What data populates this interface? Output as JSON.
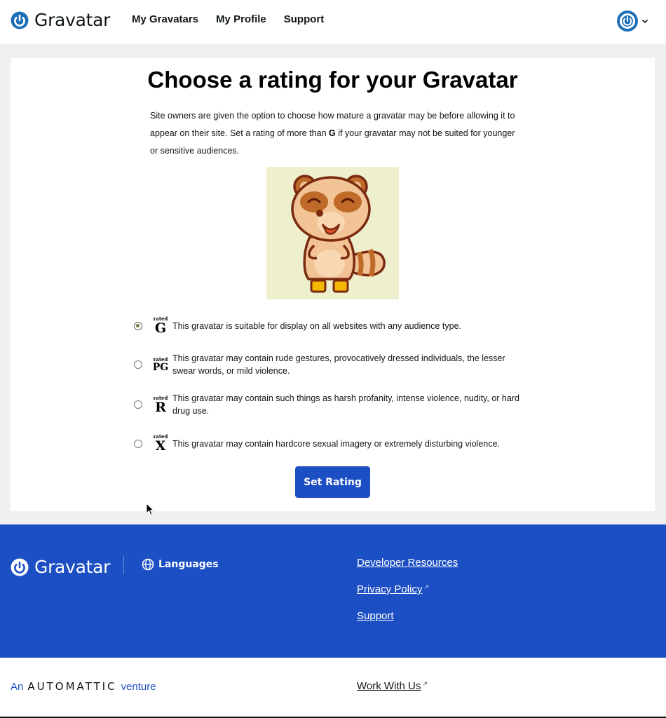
{
  "header": {
    "brand": "Gravatar",
    "nav": [
      "My Gravatars",
      "My Profile",
      "Support"
    ],
    "avatar_icon": "gravatar-logo-icon",
    "dropdown_icon": "chevron-down-icon"
  },
  "main": {
    "title": "Choose a rating for your Gravatar",
    "intro_part1": "Site owners are given the option to choose how mature a gravatar may be before allowing it to appear on their site. Set a rating of more than ",
    "intro_bold": "G",
    "intro_part2": " if your gravatar may not be suited for younger or sensitive audiences.",
    "ratings": [
      {
        "badge_top": "rated",
        "badge_letter": "G",
        "description": "This gravatar is suitable for display on all websites with any audience type.",
        "selected": true
      },
      {
        "badge_top": "rated",
        "badge_letter": "PG",
        "description": "This gravatar may contain rude gestures, provocatively dressed individuals, the lesser swear words, or mild violence.",
        "selected": false
      },
      {
        "badge_top": "rated",
        "badge_letter": "R",
        "description": "This gravatar may contain such things as harsh profanity, intense violence, nudity, or hard drug use.",
        "selected": false
      },
      {
        "badge_top": "rated",
        "badge_letter": "X",
        "description": "This gravatar may contain hardcore sexual imagery or extremely disturbing violence.",
        "selected": false
      }
    ],
    "button_label": "Set Rating"
  },
  "footer": {
    "brand": "Gravatar",
    "languages_label": "Languages",
    "links": [
      "Developer Resources",
      "Privacy Policy",
      "Support"
    ]
  },
  "bottom": {
    "prefix": "An",
    "wordmark": "AUTOMATTIC",
    "suffix": "venture",
    "work_link": "Work With Us"
  },
  "colors": {
    "brand_blue": "#1d4fc4",
    "logo_blue": "#1d6fb8",
    "mascot_bg": "#eeefcd"
  }
}
